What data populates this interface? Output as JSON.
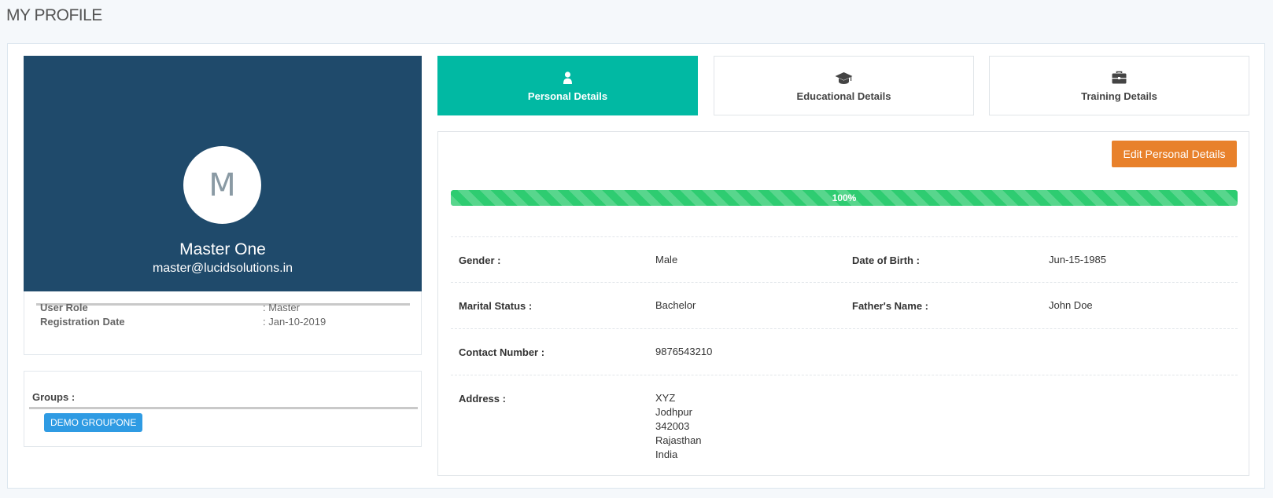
{
  "page": {
    "title": "MY PROFILE"
  },
  "profile": {
    "initial": "M",
    "name": "Master One",
    "email": "master@lucidsolutions.in",
    "info": [
      {
        "label": "User Role",
        "value": ": Master"
      },
      {
        "label": "Registration Date",
        "value": ": Jan-10-2019"
      }
    ],
    "groups_label": "Groups :",
    "groups": [
      "DEMO GROUPONE"
    ]
  },
  "tabs": [
    {
      "label": "Personal Details",
      "icon": "user-icon",
      "active": true
    },
    {
      "label": "Educational Details",
      "icon": "graduation-cap-icon",
      "active": false
    },
    {
      "label": "Training Details",
      "icon": "briefcase-icon",
      "active": false
    }
  ],
  "details": {
    "edit_button": "Edit Personal Details",
    "progress": {
      "value": 100,
      "label": "100%"
    },
    "fields": {
      "gender": {
        "label": "Gender :",
        "value": "Male"
      },
      "dob": {
        "label": "Date of Birth :",
        "value": "Jun-15-1985"
      },
      "marital": {
        "label": "Marital Status :",
        "value": "Bachelor"
      },
      "father": {
        "label": "Father's Name :",
        "value": "John Doe"
      },
      "contact": {
        "label": "Contact Number :",
        "value": "9876543210"
      },
      "address": {
        "label": "Address :",
        "lines": [
          "XYZ",
          "Jodhpur",
          "342003",
          "Rajasthan",
          "India"
        ]
      }
    }
  },
  "colors": {
    "profile_card_bg": "#1f4a6b",
    "active_tab": "#01b9a3",
    "edit_button": "#e8812b",
    "progress": "#2ecc71",
    "group_badge": "#2f9be3"
  }
}
